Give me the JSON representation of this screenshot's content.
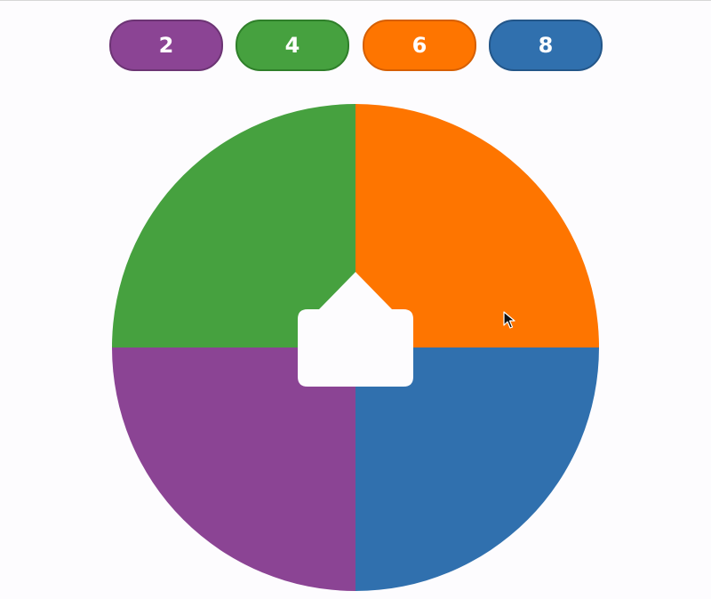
{
  "buttons": [
    {
      "label": "2",
      "color": "#8b4494",
      "border": "#6c3474"
    },
    {
      "label": "4",
      "color": "#46a13f",
      "border": "#2f7f2a"
    },
    {
      "label": "6",
      "color": "#fe7500",
      "border": "#d65f00"
    },
    {
      "label": "8",
      "color": "#3070ae",
      "border": "#235689"
    }
  ],
  "wheel": {
    "segments": [
      {
        "quadrant": "top-right",
        "color": "#fe7500"
      },
      {
        "quadrant": "bottom-right",
        "color": "#3070ae"
      },
      {
        "quadrant": "bottom-left",
        "color": "#8b4494"
      },
      {
        "quadrant": "top-left",
        "color": "#46a13f"
      }
    ],
    "center_color": "#fdfcfe"
  },
  "icons": {
    "pointer": "spinner-arrow-icon",
    "cursor": "mouse-cursor-icon"
  }
}
